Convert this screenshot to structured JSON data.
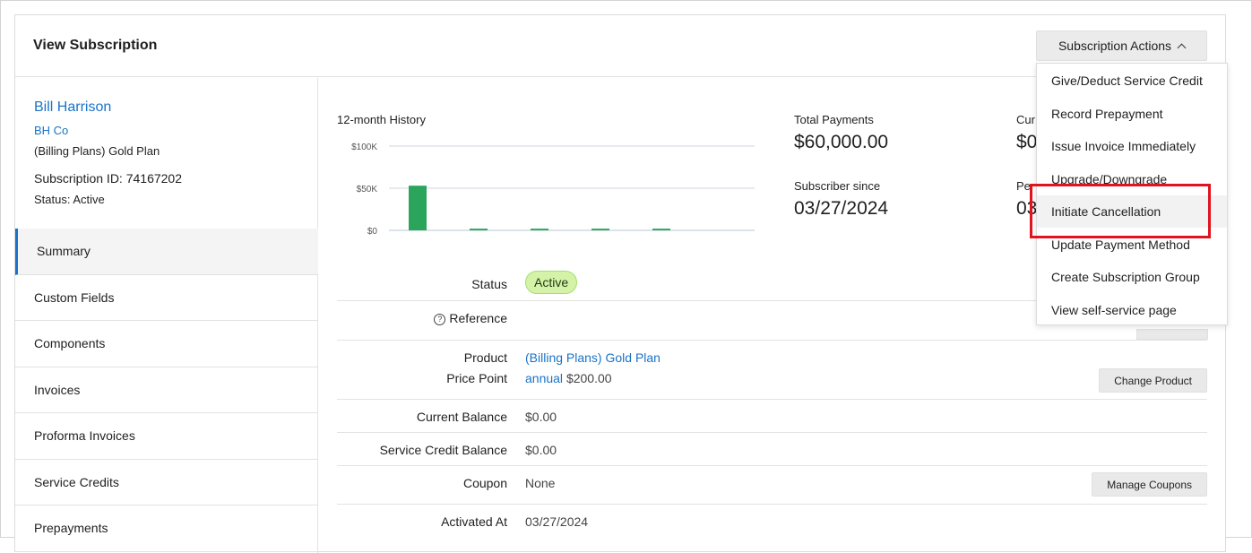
{
  "header": {
    "title": "View Subscription",
    "actions_label": "Subscription Actions"
  },
  "customer": {
    "name": "Bill Harrison",
    "company": "BH Co",
    "plan": "(Billing Plans) Gold Plan",
    "subscription_id": "Subscription ID: 74167202",
    "status": "Status: Active"
  },
  "nav": {
    "items": [
      {
        "label": "Summary",
        "active": true
      },
      {
        "label": "Custom Fields"
      },
      {
        "label": "Components"
      },
      {
        "label": "Invoices"
      },
      {
        "label": "Proforma Invoices"
      },
      {
        "label": "Service Credits"
      },
      {
        "label": "Prepayments"
      }
    ]
  },
  "history": {
    "title": "12-month History"
  },
  "chart_data": {
    "type": "bar",
    "title": "12-month History",
    "categories": [
      "1",
      "2",
      "3",
      "4",
      "5"
    ],
    "values": [
      53000,
      2000,
      2000,
      2000,
      2000
    ],
    "ylim": [
      0,
      100000
    ],
    "yticks": [
      "$0",
      "$50K",
      "$100K"
    ],
    "grid": true,
    "bar_color": "#2ba55c"
  },
  "stats": {
    "total_payments_label": "Total Payments",
    "total_payments_value": "$60,000.00",
    "subscriber_since_label": "Subscriber since",
    "subscriber_since_value": "03/27/2024",
    "partial_label_1": "Cur",
    "partial_value_1": "$0",
    "partial_label_2": "Pe",
    "partial_value_2": "03"
  },
  "details": {
    "status_label": "Status",
    "status_value": "Active",
    "reference_label": "Reference",
    "product_label": "Product",
    "product_value": "(Billing Plans) Gold Plan",
    "price_point_label": "Price Point",
    "price_point_link": "annual",
    "price_point_amount": "$200.00",
    "change_product_button": "Change Product",
    "current_balance_label": "Current Balance",
    "current_balance_value": "$0.00",
    "service_credit_label": "Service Credit Balance",
    "service_credit_value": "$0.00",
    "coupon_label": "Coupon",
    "coupon_value": "None",
    "manage_coupons_button": "Manage Coupons",
    "activated_label": "Activated At",
    "activated_value": "03/27/2024"
  },
  "actions_menu": {
    "items": [
      "Give/Deduct Service Credit",
      "Record Prepayment",
      "Issue Invoice Immediately",
      "Upgrade/Downgrade",
      "Initiate Cancellation",
      "Update Payment Method",
      "Create Subscription Group",
      "View self-service page"
    ],
    "highlighted": "Initiate Cancellation",
    "highlight_color": "#e0141e"
  }
}
